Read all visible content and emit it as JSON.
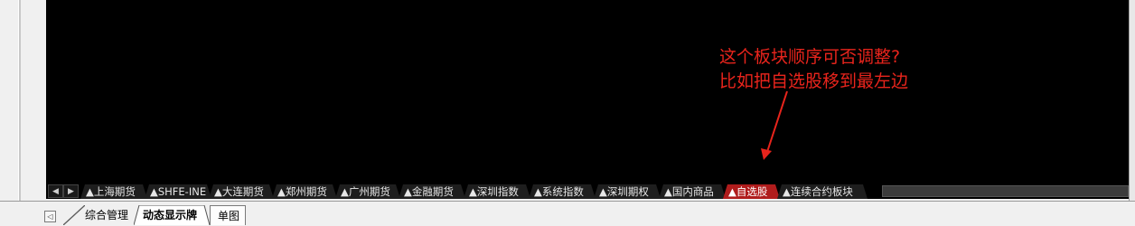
{
  "annotation": {
    "line1": "这个板块顺序可否调整?",
    "line2": "比如把自选股移到最左边",
    "color": "#e8241c"
  },
  "sheet_nav": {
    "prev_icon": "triangle-left-icon",
    "next_icon": "triangle-right-icon"
  },
  "sheet_tabs": [
    {
      "label": "▲上海期货",
      "active": false
    },
    {
      "label": "▲SHFE-INE",
      "active": false
    },
    {
      "label": "▲大连期货",
      "active": false
    },
    {
      "label": "▲郑州期货",
      "active": false
    },
    {
      "label": "▲广州期货",
      "active": false
    },
    {
      "label": "▲金融期货",
      "active": false
    },
    {
      "label": "▲深圳指数",
      "active": false
    },
    {
      "label": "▲系统指数",
      "active": false
    },
    {
      "label": "▲深圳期权",
      "active": false
    },
    {
      "label": "▲国内商品",
      "active": false
    },
    {
      "label": "▲自选股",
      "active": true
    },
    {
      "label": "▲连续合约板块",
      "active": false
    }
  ],
  "active_tab_color": "#b01c1c",
  "bottom_tabs": [
    {
      "label": "综合管理"
    },
    {
      "label": "动态显示牌"
    },
    {
      "label": "单图"
    }
  ]
}
